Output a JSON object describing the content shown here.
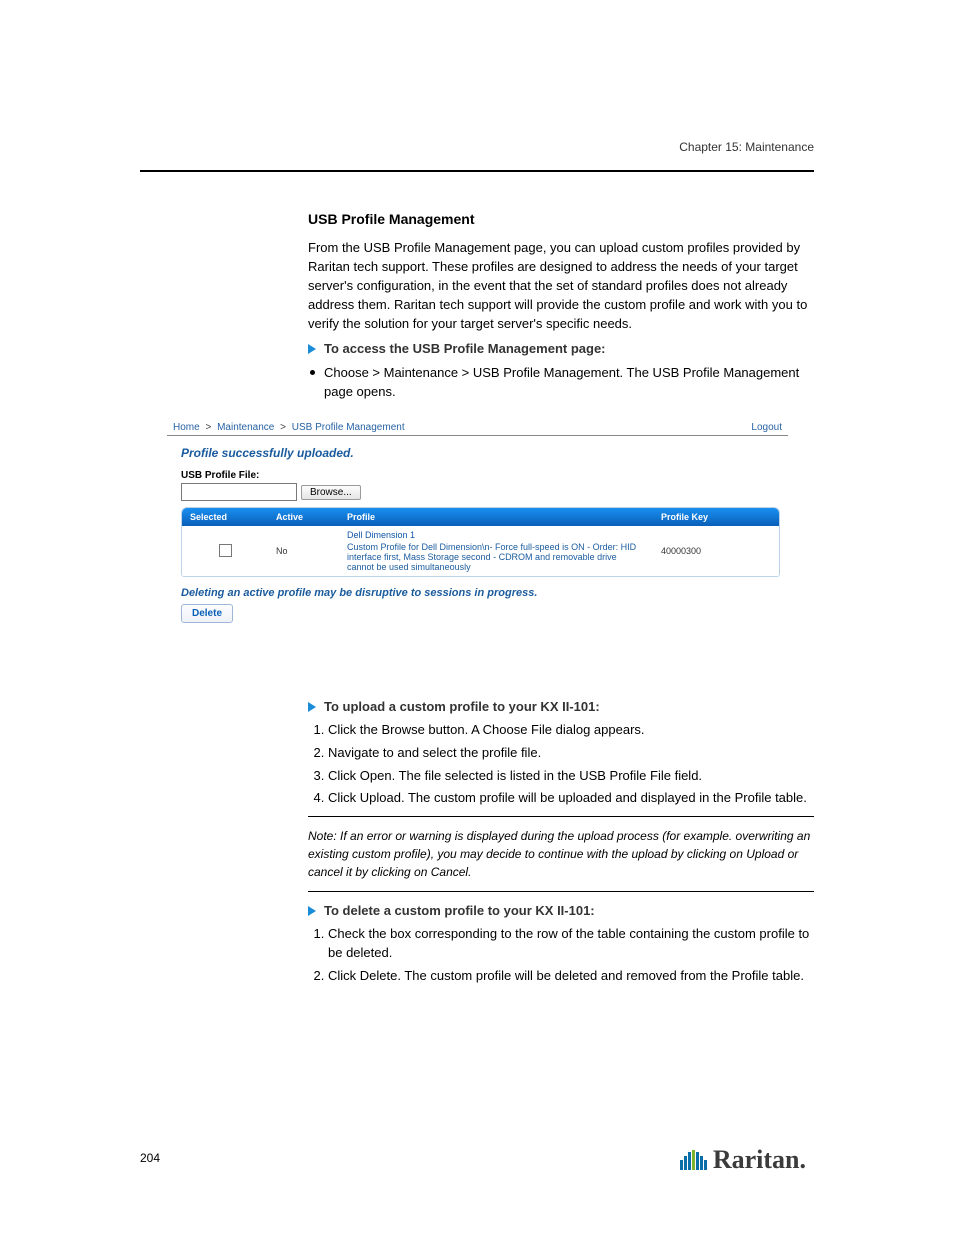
{
  "header": {
    "chapter_line": "Chapter 15: Maintenance"
  },
  "intro": {
    "heading": "USB Profile Management",
    "p1": "From the USB Profile Management page, you can upload custom profiles provided by Raritan tech support. These profiles are designed to address the needs of your target server's configuration, in the event that the set of standard profiles does not already address them. Raritan tech support will provide the custom profile and work with you to verify the solution for your target server's specific needs.",
    "proc1": "To access the USB Profile Management page:",
    "step1": "Choose > Maintenance > USB Profile Management. The USB Profile Management page opens."
  },
  "screenshot": {
    "breadcrumb": {
      "home": "Home",
      "maint": "Maintenance",
      "usb": "USB Profile Management",
      "logout": "Logout"
    },
    "status": "Profile successfully uploaded.",
    "file_label": "USB Profile File:",
    "browse": "Browse...",
    "table": {
      "headers": {
        "selected": "Selected",
        "active": "Active",
        "profile": "Profile",
        "key": "Profile Key"
      },
      "row": {
        "active": "No",
        "title": "Dell Dimension  1",
        "desc": "Custom Profile for Dell Dimension\\n- Force full-speed is ON - Order: HID interface first, Mass Storage second - CDROM and removable drive cannot be used simultaneously",
        "key": "40000300"
      }
    },
    "warning": "Deleting an active profile may be disruptive to sessions in progress.",
    "delete": "Delete"
  },
  "after": {
    "proc2": "To upload a custom profile to your KX II-101:",
    "s1": "Click the Browse button. A Choose File dialog appears.",
    "s2": "Navigate to and select the profile file.",
    "s3": "Click Open. The file selected is listed in the USB Profile File field.",
    "s4": "Click Upload. The custom profile will be uploaded and displayed in the Profile table.",
    "note": "Note: If an error or warning is displayed during the upload process (for example. overwriting an existing custom profile), you may decide to continue with the upload by clicking on Upload or cancel it by clicking on Cancel.",
    "proc3": "To delete a custom profile to your KX II-101:",
    "d1": "Check the box corresponding to the row of the table containing the custom profile to be deleted.",
    "d2": "Click Delete. The custom profile will be deleted and removed from the Profile table."
  },
  "footer": {
    "page": "204",
    "brand": "Raritan."
  }
}
